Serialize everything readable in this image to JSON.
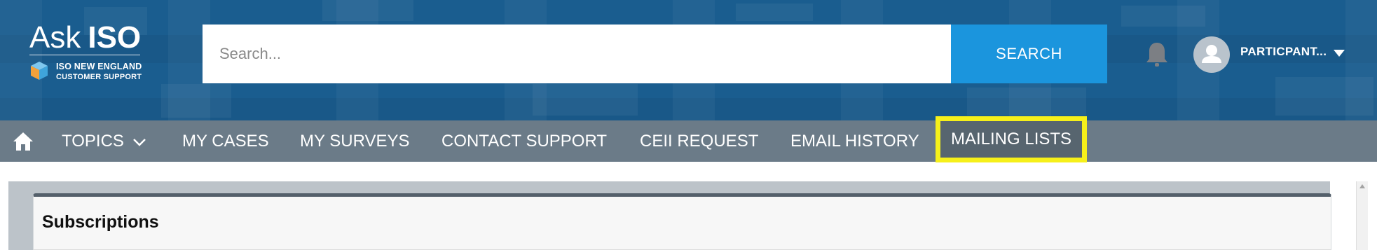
{
  "header": {
    "logo": {
      "word1": "Ask",
      "word2": "ISO",
      "line1": "ISO NEW ENGLAND",
      "line2": "CUSTOMER SUPPORT"
    },
    "search": {
      "placeholder": "Search...",
      "value": "",
      "button_label": "SEARCH"
    },
    "notifications_icon": "bell-icon",
    "user": {
      "name": "PARTICPANT...",
      "avatar_icon": "user-silhouette-icon",
      "menu_icon": "caret-down-icon"
    }
  },
  "nav": {
    "home_icon": "home-icon",
    "items": [
      {
        "label": "TOPICS",
        "has_dropdown": true
      },
      {
        "label": "MY CASES"
      },
      {
        "label": "MY SURVEYS"
      },
      {
        "label": "CONTACT SUPPORT"
      },
      {
        "label": "CEII REQUEST"
      },
      {
        "label": "EMAIL HISTORY"
      },
      {
        "label": "MAILING LISTS",
        "highlighted": true
      }
    ],
    "highlight_color": "#f6f01a"
  },
  "main": {
    "card_title": "Subscriptions"
  },
  "colors": {
    "header_bg": "#1a5d8f",
    "search_button": "#1b95dd",
    "nav_bg": "#6b7b88",
    "active_nav_bg": "#57656f"
  }
}
